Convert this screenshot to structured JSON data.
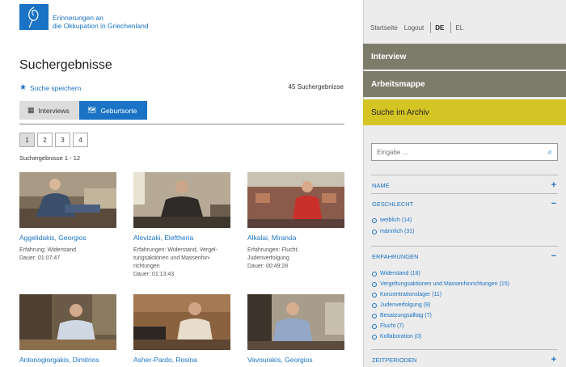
{
  "logo": {
    "line1": "Erinnerungen an",
    "line2": "die Okkupation in Griechenland"
  },
  "page_title": "Suchergebnisse",
  "save_search": "Suche speichern",
  "result_count": "45 Suchergebnisse",
  "tabs": [
    {
      "label": "Interviews",
      "icon": "grid-icon"
    },
    {
      "label": "Geburtsorte",
      "icon": "map-icon"
    }
  ],
  "pages": [
    "1",
    "2",
    "3",
    "4"
  ],
  "range": "Suchergebnisse 1 - 12",
  "cards": [
    {
      "name": "Aggelidakis, Georgios",
      "meta1": "Erfahrung: Widerstand",
      "meta2": "Dauer: 01:07:47",
      "meta3": "",
      "meta4": ""
    },
    {
      "name": "Alevizaki, Eleftheria",
      "meta1": "Erfahrungen: Widerstand, Vergel-",
      "meta2": "tungsaktionen und Massenhin-",
      "meta3": "richtungen",
      "meta4": "Dauer: 01:13:43"
    },
    {
      "name": "Alkalai, Miranda",
      "meta1": "Erfahrungen: Flucht,",
      "meta2": "Judenverfolgung",
      "meta3": "Dauer: 00:49:28",
      "meta4": ""
    },
    {
      "name": "Antonogiorgakis, Dimitrios"
    },
    {
      "name": "Asher-Pardo, Rosina"
    },
    {
      "name": "Vavourakis, Georgios"
    }
  ],
  "nav": {
    "home": "Startseite",
    "logout": "Logout",
    "lang_de": "DE",
    "lang_el": "EL"
  },
  "menu": {
    "interview": "Interview",
    "workbook": "Arbeitsmappe",
    "archive_search": "Suche im Archiv"
  },
  "search": {
    "placeholder": "Eingabe ..."
  },
  "facets": {
    "name": "NAME",
    "gender": {
      "title": "GESCHLECHT",
      "options": [
        "weiblich (14)",
        "männlich (31)"
      ]
    },
    "experiences": {
      "title": "ERFAHRUNGEN",
      "options": [
        "Widerstand (18)",
        "Vergeltungsaktionen und Massenhinrichtungen (15)",
        "Konzentrationslager (11)",
        "Judenverfolgung (9)",
        "Besatzungsalltag (7)",
        "Flucht (7)",
        "Kollaboration (0)"
      ]
    },
    "periods": "ZEITPERIODEN"
  },
  "colors": {
    "accent": "#1a73c4",
    "menu": "#7d7c6b",
    "active_menu": "#d4c424"
  }
}
